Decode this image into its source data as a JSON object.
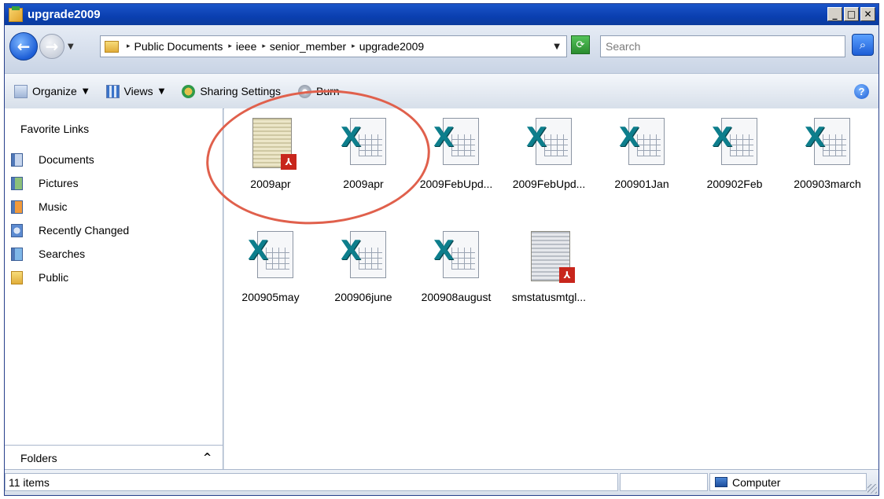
{
  "window": {
    "title": "upgrade2009"
  },
  "title_buttons": {
    "minimize": "_",
    "maximize": "□",
    "close": "✕"
  },
  "address": {
    "path": [
      "Public Documents",
      "ieee",
      "senior_member",
      "upgrade2009"
    ],
    "search_placeholder": "Search"
  },
  "toolbar": {
    "organize": "Organize",
    "views": "Views",
    "sharing": "Sharing Settings",
    "burn": "Burn",
    "help": "?"
  },
  "nav": {
    "heading": "Favorite Links",
    "links": [
      {
        "label": "Documents",
        "icon": "documents-icon"
      },
      {
        "label": "Pictures",
        "icon": "pictures-icon"
      },
      {
        "label": "Music",
        "icon": "music-icon"
      },
      {
        "label": "Recently Changed",
        "icon": "recently-changed-icon"
      },
      {
        "label": "Searches",
        "icon": "searches-icon"
      },
      {
        "label": "Public",
        "icon": "public-folder-icon"
      }
    ],
    "folders": "Folders"
  },
  "files": [
    {
      "name": "2009apr",
      "type": "pdf"
    },
    {
      "name": "2009apr",
      "type": "excel"
    },
    {
      "name": "2009FebUpd...",
      "type": "excel"
    },
    {
      "name": "2009FebUpd...",
      "type": "excel"
    },
    {
      "name": "200901Jan",
      "type": "excel"
    },
    {
      "name": "200902Feb",
      "type": "excel"
    },
    {
      "name": "200903march",
      "type": "excel"
    },
    {
      "name": "200905may",
      "type": "excel"
    },
    {
      "name": "200906june",
      "type": "excel"
    },
    {
      "name": "200908august",
      "type": "excel"
    },
    {
      "name": "smstatusmtgl...",
      "type": "pdf"
    }
  ],
  "status": {
    "count": "11 items",
    "location": "Computer"
  },
  "colors": {
    "titlebar": "#0a3fb0",
    "annotation_circle": "#e0604c",
    "excel_green": "#0d7e8c",
    "pdf_red": "#c8261c"
  }
}
